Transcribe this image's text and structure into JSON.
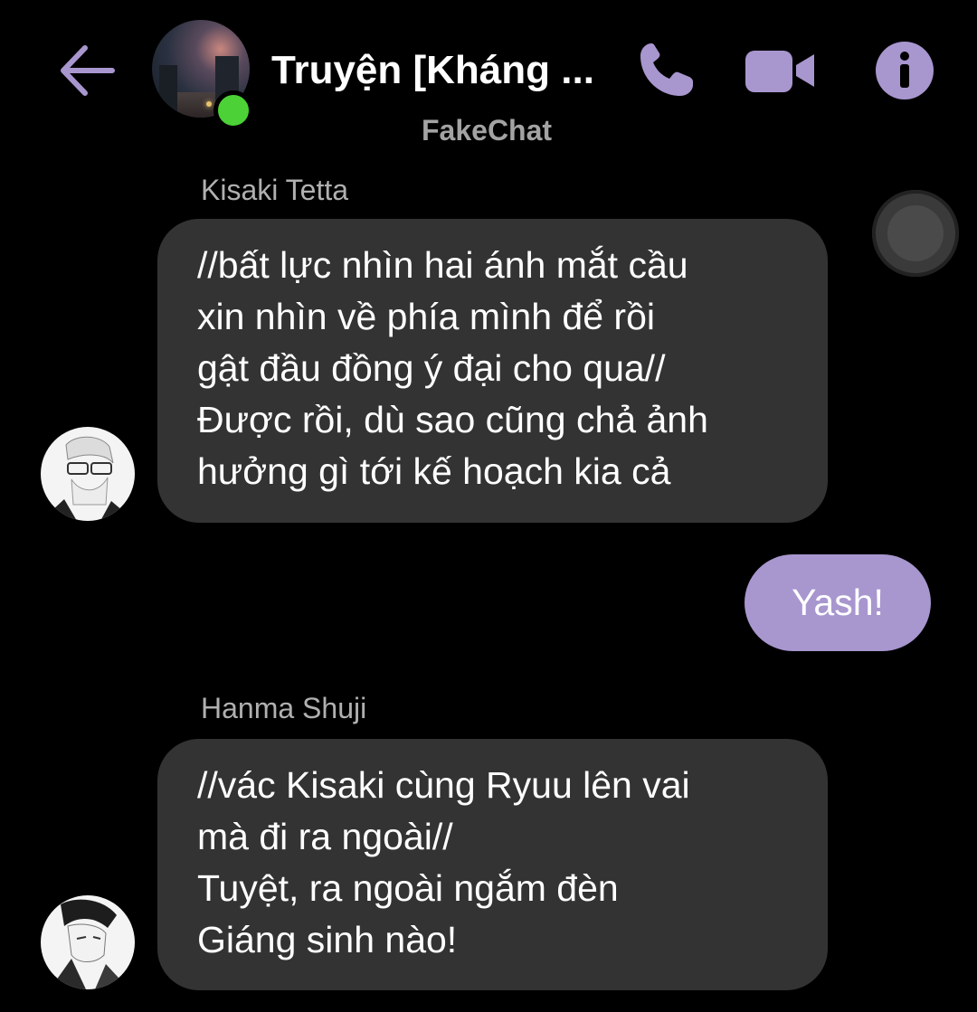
{
  "header": {
    "title": "Truyện [Kháng ...",
    "subtitle": "FakeChat",
    "back_icon": "arrow-left-icon",
    "call_icon": "phone-icon",
    "video_icon": "video-camera-icon",
    "info_icon": "info-icon",
    "online": true
  },
  "messages": [
    {
      "sender": "Kisaki Tetta",
      "direction": "incoming",
      "lines": [
        "//bất lực nhìn hai ánh mắt cầu",
        "xin nhìn về phía mình để rồi",
        "gật đầu đồng ý đại cho qua//",
        "Được rồi, dù sao cũng chả ảnh",
        "hưởng gì tới kế hoạch kia cả"
      ]
    },
    {
      "direction": "outgoing",
      "text": "Yash!"
    },
    {
      "sender": "Hanma Shuji",
      "direction": "incoming",
      "lines": [
        "//vác Kisaki cùng Ryuu lên vai",
        "mà đi ra ngoài//",
        "Tuyệt, ra ngoài ngắm đèn",
        "Giáng sinh nào!"
      ]
    }
  ],
  "colors": {
    "background": "#000000",
    "accent": "#a896cf",
    "incoming_bubble": "#333333",
    "online": "#4cd137",
    "secondary_text": "#a3a3a3"
  }
}
